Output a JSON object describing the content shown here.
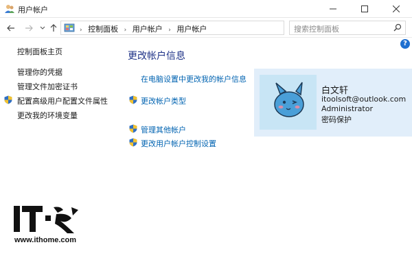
{
  "window": {
    "title": "用户帐户"
  },
  "address": {
    "crumbs": [
      "控制面板",
      "用户帐户",
      "用户帐户"
    ],
    "search_placeholder": "搜索控制面板"
  },
  "left_nav": {
    "home": "控制面板主页",
    "items": [
      "管理你的凭据",
      "管理文件加密证书",
      "配置高级用户配置文件属性",
      "更改我的环境变量"
    ]
  },
  "main": {
    "title": "更改帐户信息",
    "links": [
      "在电脑设置中更改我的帐户信息",
      "更改帐户类型",
      "管理其他帐户",
      "更改用户帐户控制设置"
    ]
  },
  "account": {
    "name": "白文轩",
    "email": "itoolsoft@outlook.com",
    "role": "Administrator",
    "password_status": "密码保护"
  },
  "watermark": {
    "brand": "IT之家",
    "url": "www.ithome.com"
  },
  "icons": [
    "user-accounts-icon",
    "minimize-icon",
    "maximize-icon",
    "close-icon",
    "back-arrow-icon",
    "forward-arrow-icon",
    "up-arrow-icon",
    "control-panel-icon",
    "refresh-icon",
    "search-icon",
    "help-icon",
    "uac-shield-icon"
  ],
  "colors": {
    "link": "#0063b1",
    "title": "#1e3287",
    "card_bg": "#e1eefa",
    "avatar_bg": "#c8e5f5"
  }
}
